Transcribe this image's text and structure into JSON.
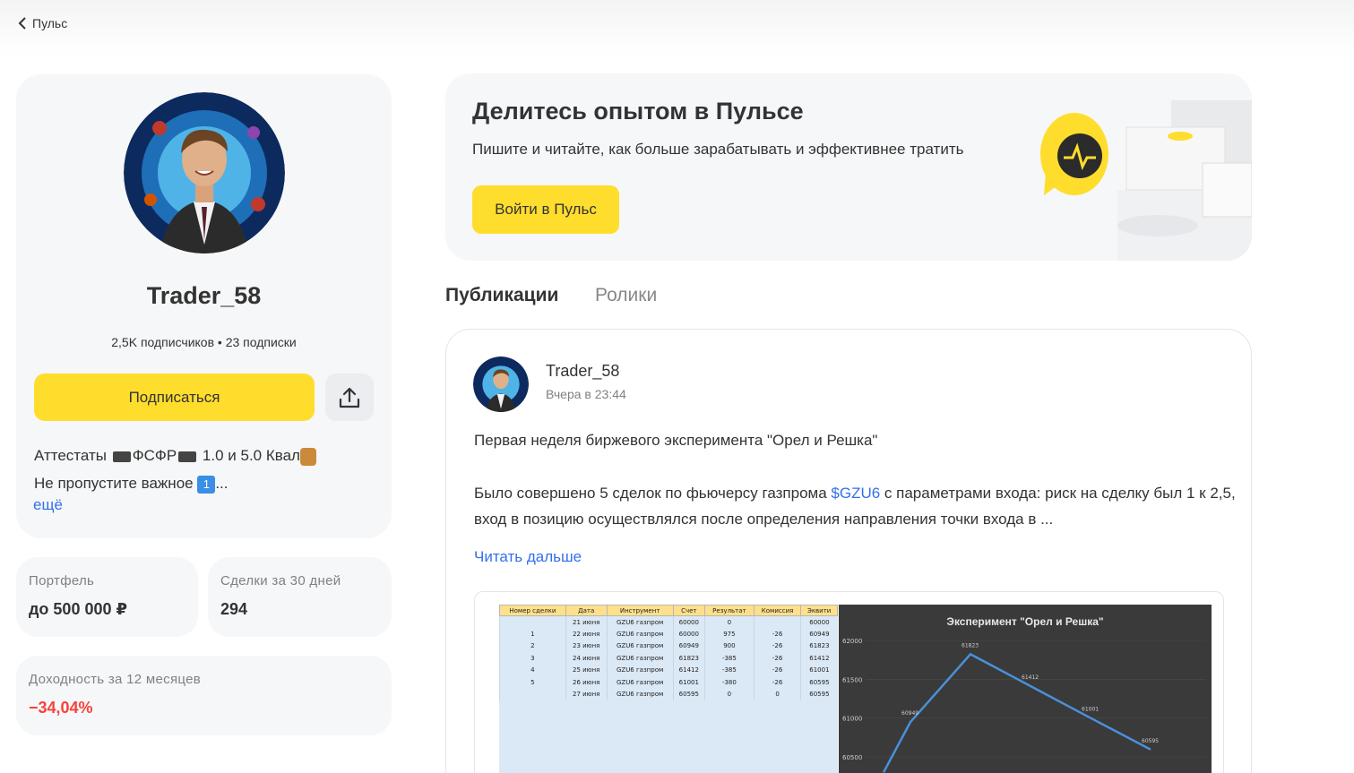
{
  "nav": {
    "back_label": "Пульс"
  },
  "profile": {
    "name": "Trader_58",
    "stats": "2,5K подписчиков • 23 подписки",
    "subscribe_label": "Подписаться",
    "bio_line1_a": "Аттестаты ",
    "bio_line1_b": "ФСФР",
    "bio_line1_c": " 1.0 и 5.0 Квал",
    "bio_line2_a": "Не пропустите важное ",
    "bio_line2_emoji": "1",
    "bio_line2_b": "...",
    "more_label": "ещё"
  },
  "stats": {
    "portfolio_label": "Портфель",
    "portfolio_value": "до 500 000 ₽",
    "deals_label": "Сделки за 30 дней",
    "deals_value": "294",
    "yield_label": "Доходность за 12 месяцев",
    "yield_value": "−34,04%",
    "yield_color": "#f5433b"
  },
  "banner": {
    "title": "Делитесь опытом в Пульсе",
    "subtitle": "Пишите и читайте, как больше зарабатывать и эффективнее тратить",
    "button_label": "Войти в Пульс"
  },
  "tabs": [
    {
      "label": "Публикации",
      "active": true
    },
    {
      "label": "Ролики",
      "active": false
    }
  ],
  "post": {
    "author": "Trader_58",
    "time": "Вчера в 23:44",
    "para1": "Первая неделя биржевого эксперимента \"Орел и Решка\"",
    "para2_a": "Было совершено 5 сделок по фьючерсу газпрома ",
    "para2_ticker": "$GZU6",
    "para2_b": " с параметрами входа: риск на сделку был 1 к 2,5, вход в позицию осуществлялся после определения направления точки входа в ...",
    "read_more": "Читать дальше",
    "sheet": {
      "headers": [
        "Номер сделки",
        "Дата",
        "Инструмент",
        "Счет",
        "Результат",
        "Комиссия",
        "Эквити"
      ],
      "rows": [
        [
          "",
          "21 июня",
          "GZU6 газпром",
          "60000",
          "0",
          "",
          "60000"
        ],
        [
          "1",
          "22 июня",
          "GZU6 газпром",
          "60000",
          "975",
          "-26",
          "60949"
        ],
        [
          "2",
          "23 июня",
          "GZU6 газпром",
          "60949",
          "900",
          "-26",
          "61823"
        ],
        [
          "3",
          "24 июня",
          "GZU6 газпром",
          "61823",
          "-385",
          "-26",
          "61412"
        ],
        [
          "4",
          "25 июня",
          "GZU6 газпром",
          "61412",
          "-385",
          "-26",
          "61001"
        ],
        [
          "5",
          "26 июня",
          "GZU6 газпром",
          "61001",
          "-380",
          "-26",
          "60595"
        ],
        [
          "",
          "27 июня",
          "GZU6 газпром",
          "60595",
          "0",
          "0",
          "60595"
        ]
      ]
    },
    "chart_data": {
      "type": "line",
      "title": "Эксперимент \"Орел и Решка\"",
      "yticks": [
        "62000",
        "61500",
        "61000",
        "60500"
      ],
      "ylim": [
        60500,
        62000
      ],
      "x": [
        1,
        2,
        3,
        4,
        5
      ],
      "values": [
        60949,
        61823,
        61412,
        61001,
        60595
      ],
      "point_labels": [
        "60949",
        "61823",
        "61412",
        "61001",
        "60595"
      ],
      "line_color": "#4a90d9"
    }
  }
}
